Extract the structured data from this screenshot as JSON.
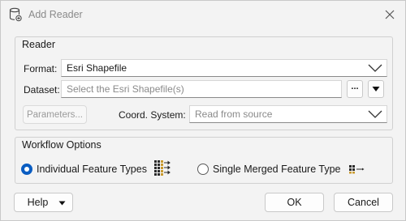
{
  "window": {
    "title": "Add Reader",
    "close_icon": "close-icon"
  },
  "reader": {
    "group_title": "Reader",
    "format_label": "Format:",
    "format_value": "Esri Shapefile",
    "dataset_label": "Dataset:",
    "dataset_placeholder": "Select the Esri Shapefile(s)",
    "browse_label": "...",
    "parameters_label": "Parameters...",
    "coord_label": "Coord. System:",
    "coord_value": "Read from source"
  },
  "workflow": {
    "group_title": "Workflow Options",
    "option_individual": "Individual Feature Types",
    "option_single": "Single Merged Feature Type",
    "selected": "individual"
  },
  "footer": {
    "help_label": "Help",
    "ok_label": "OK",
    "cancel_label": "Cancel"
  },
  "colors": {
    "accent": "#0a5dc2"
  }
}
